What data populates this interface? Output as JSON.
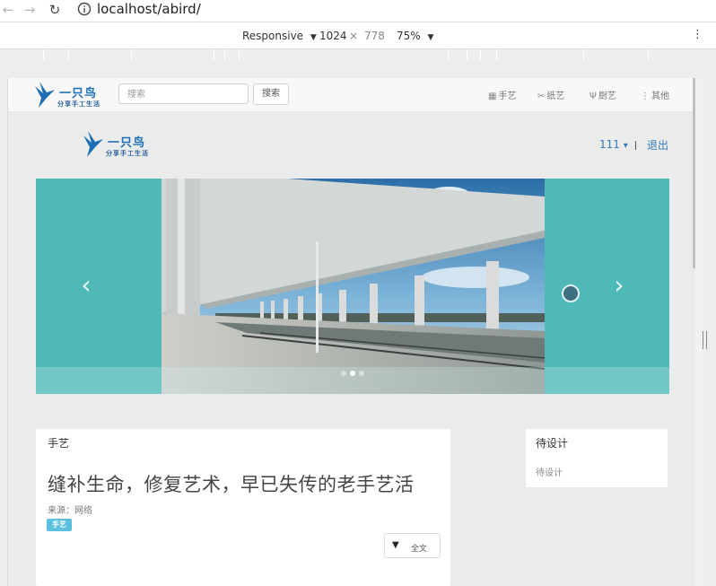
{
  "browser": {
    "back_icon": "←",
    "forward_icon": "→",
    "reload_icon": "↻",
    "url": "localhost/abird/",
    "device_mode": "Responsive",
    "width": "1024",
    "times": "×",
    "height": "778",
    "zoom": "75%",
    "menu_icon": "⋮"
  },
  "site": {
    "logo_text": "一只鸟",
    "logo_tagline": "分享手工生活",
    "search_placeholder": "搜索",
    "search_button": "搜索",
    "nav": [
      {
        "icon": "gift-icon",
        "glyph": "▦",
        "label": "手艺"
      },
      {
        "icon": "scissors-icon",
        "glyph": "✂",
        "label": "纸艺"
      },
      {
        "icon": "cutlery-icon",
        "glyph": "Ψ",
        "label": "厨艺"
      },
      {
        "icon": "more-icon",
        "glyph": "⋮",
        "label": "其他"
      }
    ],
    "user": "111",
    "user_caret": "▾",
    "divider": "|",
    "logout": "退出"
  },
  "carousel": {
    "prev_icon": "‹",
    "next_icon": "›",
    "slide_count": 3,
    "active_index": 1
  },
  "article": {
    "category": "手艺",
    "title": "缝补生命，修复艺术，早已失传的老手艺活",
    "source": "来源：网络",
    "tag": "手艺",
    "full_button": "全文",
    "caret": "▼"
  },
  "sidebar": {
    "title": "待设计",
    "text": "待设计"
  },
  "colors": {
    "brand": "#1c6fb5",
    "carousel_bg": "#4fb9b8",
    "link": "#337ab7",
    "tag": "#5bc0de"
  }
}
